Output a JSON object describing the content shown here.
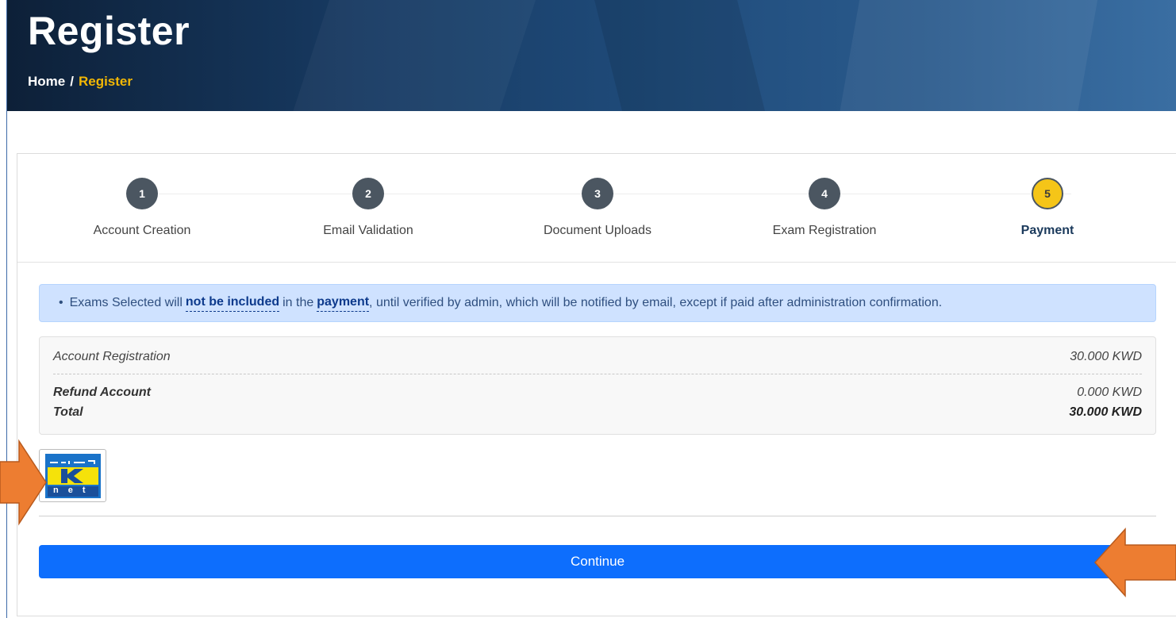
{
  "hero": {
    "title": "Register",
    "breadcrumb": {
      "home": "Home",
      "separator": "/",
      "current": "Register"
    }
  },
  "stepper": {
    "steps": [
      {
        "number": "1",
        "label": "Account Creation",
        "active": false
      },
      {
        "number": "2",
        "label": "Email Validation",
        "active": false
      },
      {
        "number": "3",
        "label": "Document Uploads",
        "active": false
      },
      {
        "number": "4",
        "label": "Exam Registration",
        "active": false
      },
      {
        "number": "5",
        "label": "Payment",
        "active": true
      }
    ]
  },
  "notice": {
    "part1": "Exams Selected will",
    "highlight1": "not be included",
    "part2": "in the",
    "highlight2": "payment",
    "part3": ", until verified by admin, which will be notified by email, except if paid after administration confirmation."
  },
  "summary": {
    "rows": [
      {
        "label": "Account Registration",
        "amount": "30.000 KWD"
      },
      {
        "label": "Refund Account",
        "amount": "0.000 KWD"
      },
      {
        "label": "Total",
        "amount": "30.000 KWD"
      }
    ]
  },
  "payment": {
    "method_icon": "knet-logo",
    "knet_text": "net"
  },
  "actions": {
    "continue_label": "Continue"
  },
  "colors": {
    "primary": "#0d6efd",
    "accent": "#f5c518",
    "step": "#4b5661",
    "arrow": "#ed7d31"
  }
}
